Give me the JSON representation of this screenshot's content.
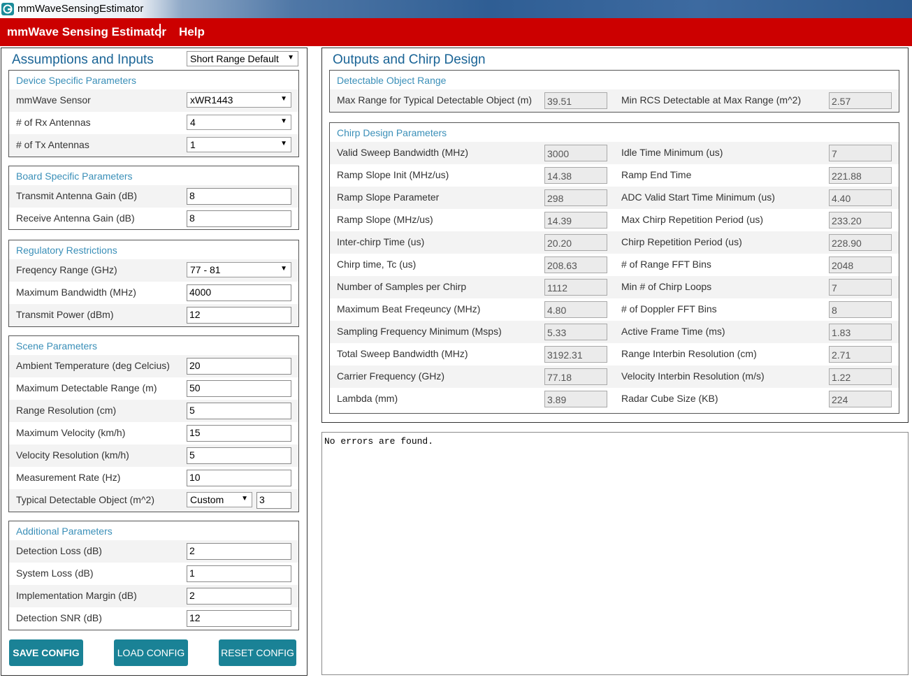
{
  "window": {
    "title": "mmWaveSensingEstimator"
  },
  "menu": {
    "app_name": "mmWave Sensing Estimator",
    "help": "Help"
  },
  "left": {
    "title": "Assumptions and Inputs",
    "preset": "Short Range Default",
    "device": {
      "title": "Device Specific Parameters",
      "sensor_label": "mmWave Sensor",
      "sensor_value": "xWR1443",
      "rx_label": "# of Rx Antennas",
      "rx_value": "4",
      "tx_label": "# of Tx Antennas",
      "tx_value": "1"
    },
    "board": {
      "title": "Board Specific Parameters",
      "tx_gain_label": "Transmit Antenna Gain (dB)",
      "tx_gain_value": "8",
      "rx_gain_label": "Receive Antenna Gain (dB)",
      "rx_gain_value": "8"
    },
    "regulatory": {
      "title": "Regulatory Restrictions",
      "freq_label": "Freqency Range (GHz)",
      "freq_value": "77 - 81",
      "bw_label": "Maximum Bandwidth (MHz)",
      "bw_value": "4000",
      "power_label": "Transmit Power (dBm)",
      "power_value": "12"
    },
    "scene": {
      "title": "Scene Parameters",
      "temp_label": "Ambient Temperature (deg Celcius)",
      "temp_value": "20",
      "range_label": "Maximum Detectable Range (m)",
      "range_value": "50",
      "res_label": "Range Resolution (cm)",
      "res_value": "5",
      "vel_label": "Maximum Velocity (km/h)",
      "vel_value": "15",
      "velres_label": "Velocity Resolution (km/h)",
      "velres_value": "5",
      "rate_label": "Measurement Rate (Hz)",
      "rate_value": "10",
      "obj_label": "Typical Detectable Object (m^2)",
      "obj_select": "Custom",
      "obj_value": "3"
    },
    "additional": {
      "title": "Additional Parameters",
      "det_loss_label": "Detection Loss (dB)",
      "det_loss_value": "2",
      "sys_loss_label": "System Loss (dB)",
      "sys_loss_value": "1",
      "impl_label": "Implementation Margin (dB)",
      "impl_value": "2",
      "snr_label": "Detection SNR (dB)",
      "snr_value": "12"
    },
    "buttons": {
      "save": "SAVE CONFIG",
      "load": "LOAD CONFIG",
      "reset": "RESET CONFIG"
    }
  },
  "right": {
    "title": "Outputs and Chirp Design",
    "detectable": {
      "title": "Detectable Object Range",
      "max_range_label": "Max Range for Typical Detectable Object (m)",
      "max_range_value": "39.51",
      "min_rcs_label": "Min RCS Detectable at Max Range (m^2)",
      "min_rcs_value": "2.57"
    },
    "chirp": {
      "title": "Chirp Design Parameters",
      "rows": [
        {
          "l1": "Valid Sweep Bandwidth (MHz)",
          "v1": "3000",
          "l2": "Idle Time Minimum (us)",
          "v2": "7"
        },
        {
          "l1": "Ramp Slope Init (MHz/us)",
          "v1": "14.38",
          "l2": "Ramp End Time",
          "v2": "221.88"
        },
        {
          "l1": "Ramp Slope Parameter",
          "v1": "298",
          "l2": "ADC Valid Start Time Minimum (us)",
          "v2": "4.40"
        },
        {
          "l1": "Ramp Slope (MHz/us)",
          "v1": "14.39",
          "l2": "Max Chirp Repetition Period (us)",
          "v2": "233.20"
        },
        {
          "l1": "Inter-chirp Time (us)",
          "v1": "20.20",
          "l2": "Chirp Repetition Period (us)",
          "v2": "228.90"
        },
        {
          "l1": "Chirp time, Tc (us)",
          "v1": "208.63",
          "l2": "# of Range FFT Bins",
          "v2": "2048"
        },
        {
          "l1": "Number of Samples per Chirp",
          "v1": "1112",
          "l2": "Min # of Chirp Loops",
          "v2": "7"
        },
        {
          "l1": "Maximum Beat Freqeuncy (MHz)",
          "v1": "4.80",
          "l2": "# of Doppler FFT Bins",
          "v2": "8"
        },
        {
          "l1": "Sampling Frequency Minimum (Msps)",
          "v1": "5.33",
          "l2": "Active Frame Time (ms)",
          "v2": "1.83"
        },
        {
          "l1": "Total Sweep Bandwidth (MHz)",
          "v1": "3192.31",
          "l2": "Range Interbin Resolution (cm)",
          "v2": "2.71"
        },
        {
          "l1": "Carrier Frequency (GHz)",
          "v1": "77.18",
          "l2": "Velocity Interbin Resolution (m/s)",
          "v2": "1.22"
        },
        {
          "l1": "Lambda (mm)",
          "v1": "3.89",
          "l2": "Radar Cube Size (KB)",
          "v2": "224"
        }
      ]
    },
    "console_text": "No errors are found."
  }
}
